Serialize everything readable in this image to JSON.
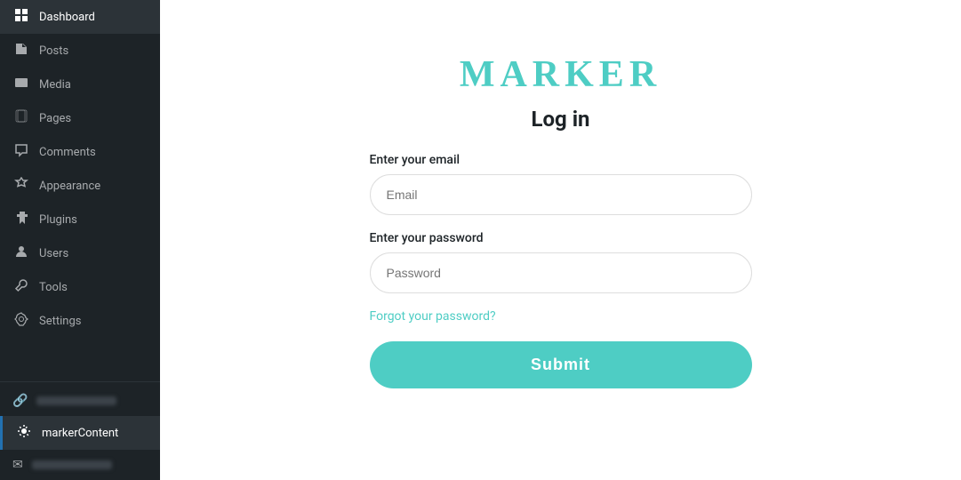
{
  "sidebar": {
    "items": [
      {
        "id": "dashboard",
        "label": "Dashboard",
        "icon": "⊞"
      },
      {
        "id": "posts",
        "label": "Posts",
        "icon": "✏"
      },
      {
        "id": "media",
        "label": "Media",
        "icon": "🖼"
      },
      {
        "id": "pages",
        "label": "Pages",
        "icon": "📄"
      },
      {
        "id": "comments",
        "label": "Comments",
        "icon": "💬"
      },
      {
        "id": "appearance",
        "label": "Appearance",
        "icon": "🎨"
      },
      {
        "id": "plugins",
        "label": "Plugins",
        "icon": "🔌"
      },
      {
        "id": "users",
        "label": "Users",
        "icon": "👤"
      },
      {
        "id": "tools",
        "label": "Tools",
        "icon": "🔧"
      },
      {
        "id": "settings",
        "label": "Settings",
        "icon": "⊞"
      }
    ],
    "bottom_items": [
      {
        "id": "link",
        "icon": "🔗"
      },
      {
        "id": "marker-content",
        "label": "markerContent",
        "icon": "⚙"
      },
      {
        "id": "mail",
        "icon": "✉"
      }
    ]
  },
  "login": {
    "brand": "MARKER",
    "heading": "Log in",
    "email_label": "Enter your email",
    "email_placeholder": "Email",
    "password_label": "Enter your password",
    "password_placeholder": "Password",
    "forgot_label": "Forgot your password?",
    "submit_label": "Submit"
  },
  "colors": {
    "brand": "#4ecdc4",
    "sidebar_bg": "#1d2327",
    "active_marker": "#2271b1"
  }
}
